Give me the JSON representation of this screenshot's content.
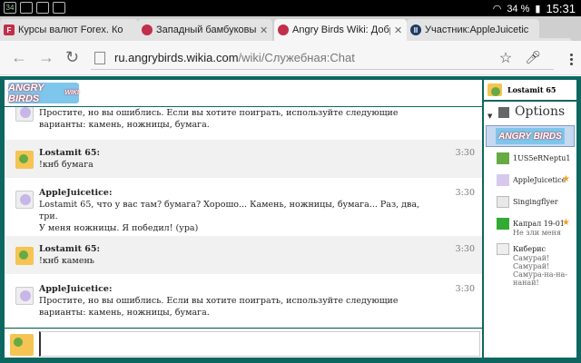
{
  "status_bar": {
    "notification_badge": "34",
    "battery": "34 %",
    "time": "15:31"
  },
  "tabs": [
    {
      "favicon": "F",
      "favicon_color": "#c0304a",
      "title": "Курсы валют Forex. Ко"
    },
    {
      "favicon": "",
      "favicon_color": "#c0304a",
      "title": "Западный бамбуковый"
    },
    {
      "favicon": "",
      "favicon_color": "#c0304a",
      "title": "Angry Birds Wiki: Добро"
    },
    {
      "favicon": "II",
      "favicon_color": "#1d3b66",
      "title": "Участник:AppleJuicetic"
    }
  ],
  "toolbar": {
    "url_host": "ru.angrybirds.wikia.com",
    "url_path": "/wiki/Служебная:Chat"
  },
  "header": {
    "logo_text": "ANGRY BIRDS",
    "logo_sub": "WIKI"
  },
  "messages": [
    {
      "name": "",
      "time": "",
      "text": "Простите, но вы ошиблись. Если вы хотите поиграть, используйте следующие варианты: камень, ножницы, бумага.",
      "avatar": "pony"
    },
    {
      "name": "Lostamit 65:",
      "time": "3:30",
      "text": "!кнб бумага",
      "avatar": "bird"
    },
    {
      "name": "AppleJuicetice:",
      "time": "3:30",
      "text": "Lostamit 65, что у вас там? бумага? Хорошо... Камень, ножницы, бумага... Раз, два, три.\nУ меня ножницы. Я победил! (ура)",
      "avatar": "pony"
    },
    {
      "name": "Lostamit 65:",
      "time": "3:30",
      "text": "!кнб камень",
      "avatar": "bird"
    },
    {
      "name": "AppleJuicetice:",
      "time": "3:30",
      "text": "Простите, но вы ошиблись. Если вы хотите поиграть, используйте следующие варианты: камень, ножницы, бумага.",
      "avatar": "pony"
    }
  ],
  "sidebar": {
    "self_name": "Lostamit 65",
    "options_label": "Options",
    "room_logo": "ANGRY BIRDS",
    "users": [
      {
        "name": "1US5eRNeptu1",
        "status": "",
        "star": false
      },
      {
        "name": "AppleJuicetice",
        "status": "",
        "star": true
      },
      {
        "name": "Singingflyer",
        "status": "",
        "star": false
      },
      {
        "name": "Капрал 19-01",
        "status": "Не зли меня",
        "star": true
      },
      {
        "name": "Киберис",
        "status": "Самурай! Самурай! Самура-на-на-нанай!",
        "star": false
      }
    ]
  },
  "colors": {
    "frame": "#0d6760",
    "tab_bar": "#cfcfcf",
    "star": "#f0a020"
  }
}
